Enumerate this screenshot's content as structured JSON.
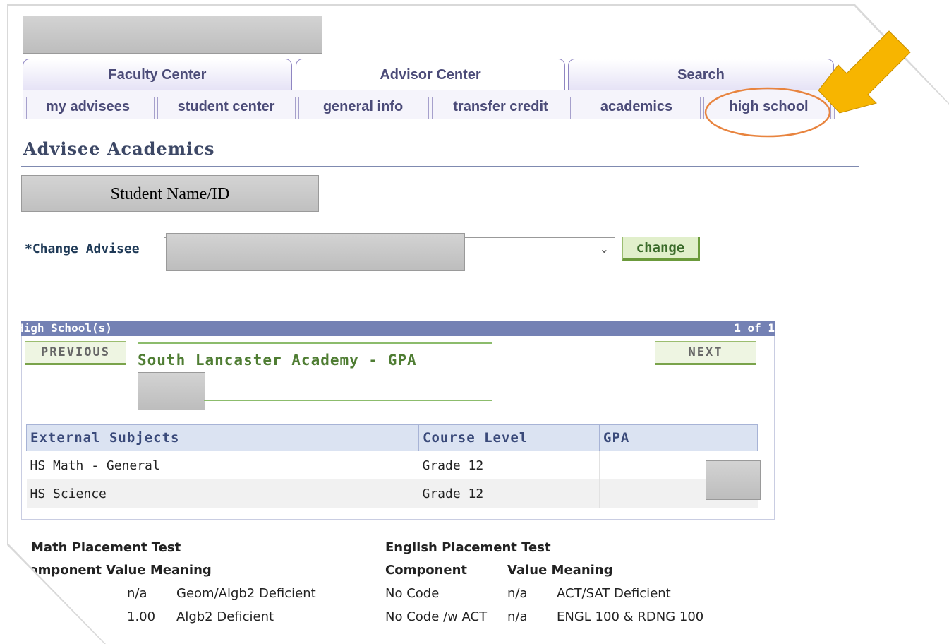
{
  "tabs": [
    {
      "label": "Faculty Center"
    },
    {
      "label": "Advisor Center"
    },
    {
      "label": "Search"
    }
  ],
  "subtabs": [
    {
      "label": "my advisees"
    },
    {
      "label": "student center"
    },
    {
      "label": "general info"
    },
    {
      "label": "transfer credit"
    },
    {
      "label": "academics"
    },
    {
      "label": "high school"
    }
  ],
  "page_title": "Advisee Academics",
  "student_label": "Student Name/ID",
  "change_advisee": {
    "label": "*Change Advisee",
    "button": "change"
  },
  "high_schools": {
    "header": "High School(s)",
    "counter": "1 of 1",
    "prev": "PREVIOUS",
    "next": "NEXT",
    "school_name": "South Lancaster Academy - GPA",
    "columns": [
      "External Subjects",
      "Course Level",
      "GPA"
    ],
    "rows": [
      {
        "subject": "HS Math - General",
        "level": "Grade 12"
      },
      {
        "subject": "HS Science",
        "level": "Grade 12"
      }
    ]
  },
  "math_test": {
    "title": "Math Placement Test",
    "header": "Component Value Meaning",
    "rows": [
      {
        "value": "n/a",
        "meaning": "Geom/Algb2 Deficient"
      },
      {
        "value": "1.00",
        "meaning": "Algb2 Deficient"
      }
    ]
  },
  "english_test": {
    "title": "English Placement Test",
    "col_component": "Component",
    "col_value_meaning": "Value Meaning",
    "rows": [
      {
        "component": "No Code",
        "value": "n/a",
        "meaning": "ACT/SAT Deficient"
      },
      {
        "component": "No Code /w ACT",
        "value": "n/a",
        "meaning": "ENGL 100 & RDNG 100"
      }
    ]
  },
  "colors": {
    "arrow": "#f7b500",
    "highlight_circle": "#e8843f",
    "header_bar": "#7481b4"
  }
}
